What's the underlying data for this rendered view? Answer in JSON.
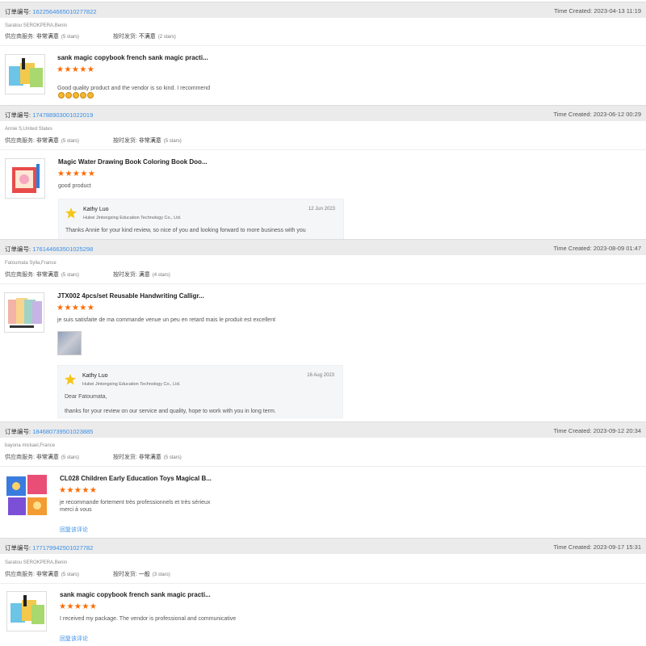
{
  "labels": {
    "order_no": "订单编号:",
    "time_created": "Time Created:",
    "supplier_service": "供应商服务:",
    "on_time": "按时发货:"
  },
  "colors": {
    "star": "#ff6a00",
    "link": "#3a8ee6",
    "header_bg": "#ebebeb"
  },
  "orders": [
    {
      "order_number": "1622564665010277822",
      "time_created": "2023-04-13 11:19",
      "buyer": "Saratou SEROKPERA,Benin",
      "service_value": "非常满意",
      "service_stars": "(5 stars)",
      "ontime_value": "不满意",
      "ontime_stars": "(2 stars)",
      "product_title": "sank magic copybook french sank magic practi...",
      "rating": "★★★★★",
      "comment": "Good quality product and the vendor is so kind. I recommend",
      "emoji_count": 5
    },
    {
      "order_number": "174788903001022019",
      "time_created": "2023-06-12 00:29",
      "buyer": "Annie S,United States",
      "service_value": "非常满意",
      "service_stars": "(5 stars)",
      "ontime_value": "非常满意",
      "ontime_stars": "(5 stars)",
      "product_title": "Magic Water Drawing Book Coloring Book Doo...",
      "rating": "★★★★★",
      "comment": "good product",
      "reply": {
        "name": "Kathy Luo",
        "company": "Hubei Jintongxing Education Technology Co., Ltd.",
        "date": "12 Jun 2023",
        "text": "Thanks Annie for your kind review, so nice of you and looking forward to more business with you"
      }
    },
    {
      "order_number": "176144663501025298",
      "time_created": "2023-08-09 01:47",
      "buyer": "Fatoumata Sylla,France",
      "service_value": "非常满意",
      "service_stars": "(5 stars)",
      "ontime_value": "满意",
      "ontime_stars": "(4 stars)",
      "product_title": "JTX002 4pcs/set Reusable Handwriting Calligr...",
      "rating": "★★★★★",
      "comment": "je suis satisfaite de ma commande venue un peu en retard mais le produit est excellent",
      "reply": {
        "name": "Kathy Luo",
        "company": "Hubei Jintongxing Education Technology Co., Ltd.",
        "date": "16 Aug 2023",
        "text": "Dear Fatoumata,\n\nthanks for your review on our service and quality, hope to work with you in long term."
      }
    },
    {
      "order_number": "184680739501023885",
      "time_created": "2023-09-12 20:34",
      "buyer": "bayona mickael,France",
      "service_value": "非常满意",
      "service_stars": "(5 stars)",
      "ontime_value": "非常满意",
      "ontime_stars": "(5 stars)",
      "product_title": "CL028 Children Early Education Toys Magical B...",
      "rating": "★★★★★",
      "comment": "je recommande fortement très professionnels et très sérieux\nmerci à vous",
      "reply_link": "回复该评论"
    },
    {
      "order_number": "177179942501027782",
      "time_created": "2023-09-17 15:31",
      "buyer": "Saratou SEROKPERA,Benin",
      "service_value": "非常满意",
      "service_stars": "(5 stars)",
      "ontime_value": "一般",
      "ontime_stars": "(3 stars)",
      "product_title": "sank magic copybook french sank magic practi...",
      "rating": "★★★★★",
      "comment": "I received my package. The vendor is professional and communicative",
      "reply_link": "回复该评论"
    }
  ]
}
